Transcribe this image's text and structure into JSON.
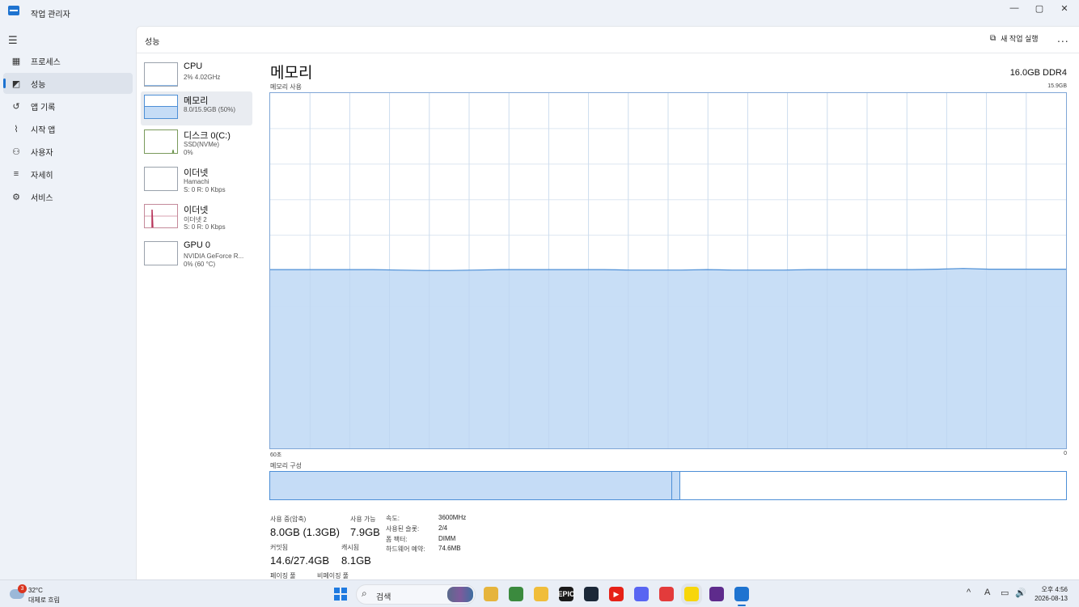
{
  "window": {
    "title": "작업 관리자"
  },
  "window_controls": {
    "minimize": "—",
    "maximize": "▢",
    "close": "✕"
  },
  "nav": {
    "items": [
      {
        "id": "processes",
        "label": "프로세스",
        "icon": "grid-icon"
      },
      {
        "id": "performance",
        "label": "성능",
        "icon": "performance-icon",
        "active": true
      },
      {
        "id": "app-history",
        "label": "앱 기록",
        "icon": "history-icon"
      },
      {
        "id": "startup",
        "label": "시작 앱",
        "icon": "startup-icon"
      },
      {
        "id": "users",
        "label": "사용자",
        "icon": "users-icon"
      },
      {
        "id": "details",
        "label": "자세히",
        "icon": "list-icon"
      },
      {
        "id": "services",
        "label": "서비스",
        "icon": "gear-icon"
      }
    ]
  },
  "header": {
    "title": "성능",
    "new_task": "새 작업 실행",
    "more": "..."
  },
  "resources": [
    {
      "name": "CPU",
      "sub1": "2% 4.02GHz",
      "sub2": ""
    },
    {
      "name": "메모리",
      "sub1": "8.0/15.9GB (50%)",
      "sub2": "",
      "active": true
    },
    {
      "name": "디스크 0(C:)",
      "sub1": "SSD(NVMe)",
      "sub2": "0%"
    },
    {
      "name": "이더넷",
      "sub1": "Hamachi",
      "sub2": "S: 0 R: 0 Kbps"
    },
    {
      "name": "이더넷",
      "sub1": "이더넷 2",
      "sub2": "S: 0 R: 0 Kbps"
    },
    {
      "name": "GPU 0",
      "sub1": "NVIDIA GeForce R...",
      "sub2": "0% (60 °C)"
    }
  ],
  "memory": {
    "title": "메모리",
    "spec": "16.0GB DDR4",
    "usage_label": "메모리 사용",
    "usage_max": "15.9GB",
    "time_left": "60초",
    "time_right": "0",
    "composition_label": "메모리 구성",
    "composition": {
      "in_use_fraction": 0.505,
      "modified_fraction": 0.01
    },
    "stats": {
      "in_use_label": "사용 중(압축)",
      "in_use_value": "8.0GB (1.3GB)",
      "available_label": "사용 가능",
      "available_value": "7.9GB",
      "committed_label": "커밋됨",
      "committed_value": "14.6/27.4GB",
      "cached_label": "캐시됨",
      "cached_value": "8.1GB",
      "paged_pool_label": "페이징 풀",
      "nonpaged_pool_label": "비페이징 풀"
    },
    "specs": [
      {
        "key": "속도:",
        "value": "3600MHz"
      },
      {
        "key": "사용된 슬롯:",
        "value": "2/4"
      },
      {
        "key": "폼 팩터:",
        "value": "DIMM"
      },
      {
        "key": "하드웨어 예약:",
        "value": "74.6MB"
      }
    ]
  },
  "chart_data": {
    "type": "area",
    "title": "메모리 사용",
    "xlabel": "",
    "ylabel": "",
    "x_range_label": [
      "60초",
      "0"
    ],
    "ylim": [
      0,
      15.9
    ],
    "grid": true,
    "series": [
      {
        "values": [
          8.0,
          8.0,
          8.0,
          8.0,
          8.0,
          7.98,
          7.96,
          7.96,
          7.98,
          8.0,
          8.0,
          8.0,
          8.0,
          8.0,
          7.98,
          7.98,
          7.98,
          8.0,
          7.98,
          7.98,
          7.98,
          8.0,
          8.0,
          8.0,
          8.0,
          8.0,
          8.02,
          8.05,
          8.02,
          8.02,
          8.02,
          8.02
        ]
      }
    ],
    "fill_color": "#c5dcf6",
    "line_color": "#4d8fd6"
  },
  "taskbar": {
    "weather_temp": "32°C",
    "weather_cond": "대체로 흐림",
    "weather_badge": "3",
    "search_placeholder": "검색",
    "apps": [
      {
        "name": "file-explorer-icon",
        "label": "",
        "color": "#e6b43c"
      },
      {
        "name": "chrome-icon",
        "label": "",
        "color": "#3b8a3e"
      },
      {
        "name": "folder-icon",
        "label": "",
        "color": "#f0bd3a"
      },
      {
        "name": "epic-games-icon",
        "label": "EPIC",
        "color": "#1a1a1a"
      },
      {
        "name": "steam-icon",
        "label": "",
        "color": "#1b2838"
      },
      {
        "name": "youtube-icon",
        "label": "▶",
        "color": "#e62117"
      },
      {
        "name": "discord-icon",
        "label": "",
        "color": "#5865f2"
      },
      {
        "name": "app-red-icon",
        "label": "",
        "color": "#e33b3b"
      },
      {
        "name": "kakaotalk-icon",
        "label": "",
        "color": "#f7d60a"
      },
      {
        "name": "app-purple-icon",
        "label": "",
        "color": "#5e2b8c"
      },
      {
        "name": "task-manager-icon",
        "label": "",
        "color": "#1e73d0"
      }
    ],
    "tray": [
      "^",
      "A",
      "▭",
      "🔊"
    ],
    "clock_time": "오후 4:56",
    "clock_date": "2026-08-13"
  }
}
